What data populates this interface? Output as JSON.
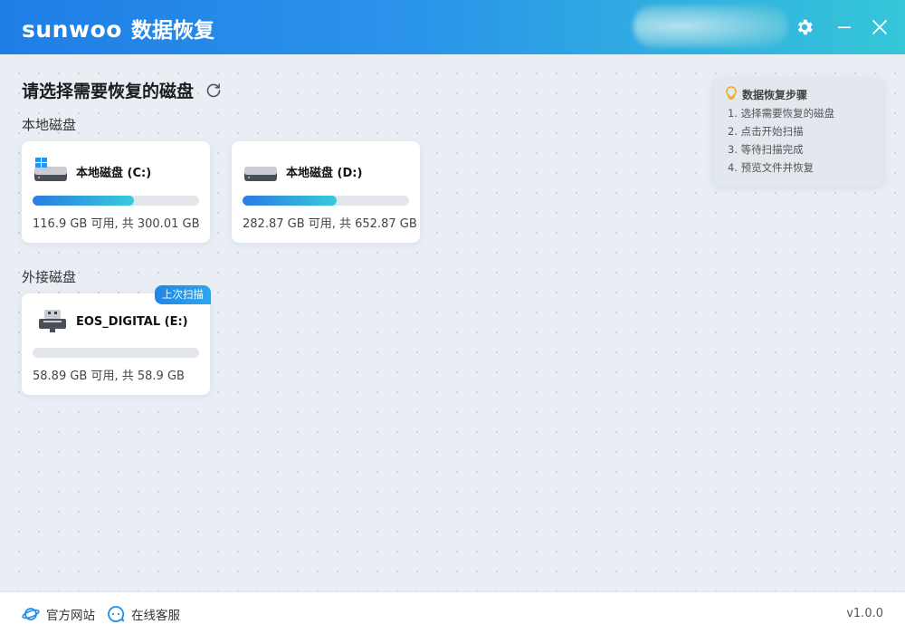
{
  "app": {
    "logo": "sunwoo",
    "name": "数据恢复",
    "version": "v1.0.0"
  },
  "colors": {
    "accent": "#1f7ee6",
    "accent_end": "#35c6d8"
  },
  "titlebar": {
    "icons": [
      "gear-icon",
      "minimize-icon",
      "close-icon"
    ]
  },
  "main": {
    "heading": "请选择需要恢复的磁盘",
    "local_label": "本地磁盘",
    "external_label": "外接磁盘",
    "local_disks": [
      {
        "name": "本地磁盘 (C:)",
        "capacity": "116.9 GB 可用, 共 300.01 GB",
        "used_fraction": 0.61,
        "icon": "windows-drive-icon"
      },
      {
        "name": "本地磁盘 (D:)",
        "capacity": "282.87 GB 可用, 共 652.87 GB",
        "used_fraction": 0.567,
        "icon": "hard-drive-icon"
      }
    ],
    "external_disks": [
      {
        "name": "EOS_DIGITAL (E:)",
        "capacity": "58.89 GB 可用, 共 58.9 GB",
        "used_fraction": 0.0,
        "badge": "上次扫描",
        "icon": "usb-drive-icon"
      }
    ]
  },
  "steps": {
    "title": "数据恢复步骤",
    "items": [
      "1. 选择需要恢复的磁盘",
      "2. 点击开始扫描",
      "3. 等待扫描完成",
      "4. 预览文件并恢复"
    ]
  },
  "footer": {
    "website": "官方网站",
    "support": "在线客服"
  }
}
